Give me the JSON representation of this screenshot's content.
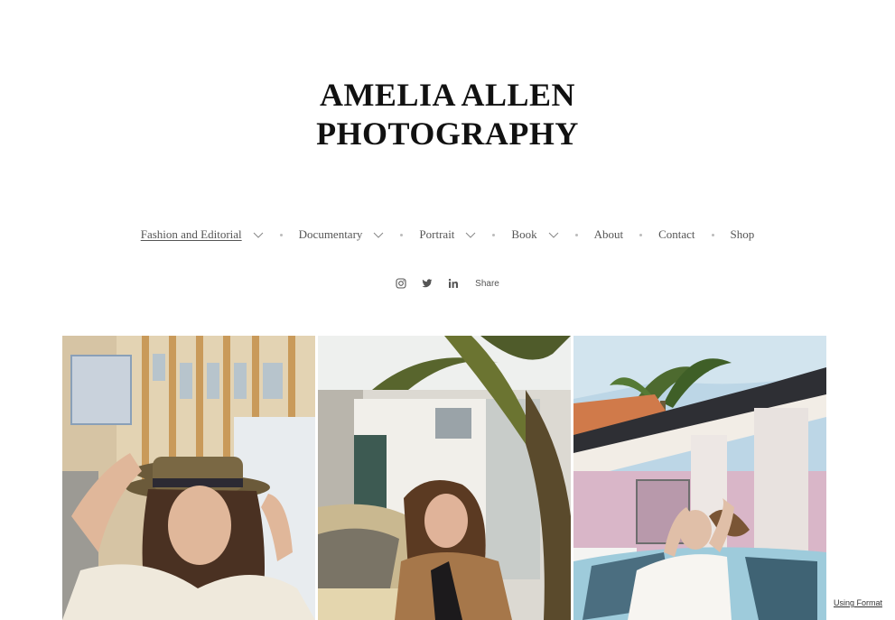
{
  "site": {
    "title_line1": "AMELIA ALLEN",
    "title_line2": "PHOTOGRAPHY"
  },
  "nav": {
    "items": [
      {
        "label": "Fashion and Editorial",
        "has_dropdown": true,
        "active": true
      },
      {
        "label": "Documentary",
        "has_dropdown": true,
        "active": false
      },
      {
        "label": "Portrait",
        "has_dropdown": true,
        "active": false
      },
      {
        "label": "Book",
        "has_dropdown": true,
        "active": false
      },
      {
        "label": "About",
        "has_dropdown": false,
        "active": false
      },
      {
        "label": "Contact",
        "has_dropdown": false,
        "active": false
      },
      {
        "label": "Shop",
        "has_dropdown": false,
        "active": false
      }
    ]
  },
  "social": {
    "icons": [
      "instagram-icon",
      "twitter-icon",
      "linkedin-icon"
    ],
    "share_label": "Share"
  },
  "gallery": {
    "photos": [
      {
        "subject": "woman-in-hat"
      },
      {
        "subject": "woman-on-car-hood"
      },
      {
        "subject": "woman-leaning-on-car"
      }
    ]
  },
  "footer": {
    "using_format_label": "Using Format"
  },
  "colors": {
    "text": "#111111",
    "nav_text": "#555555",
    "background": "#ffffff"
  }
}
